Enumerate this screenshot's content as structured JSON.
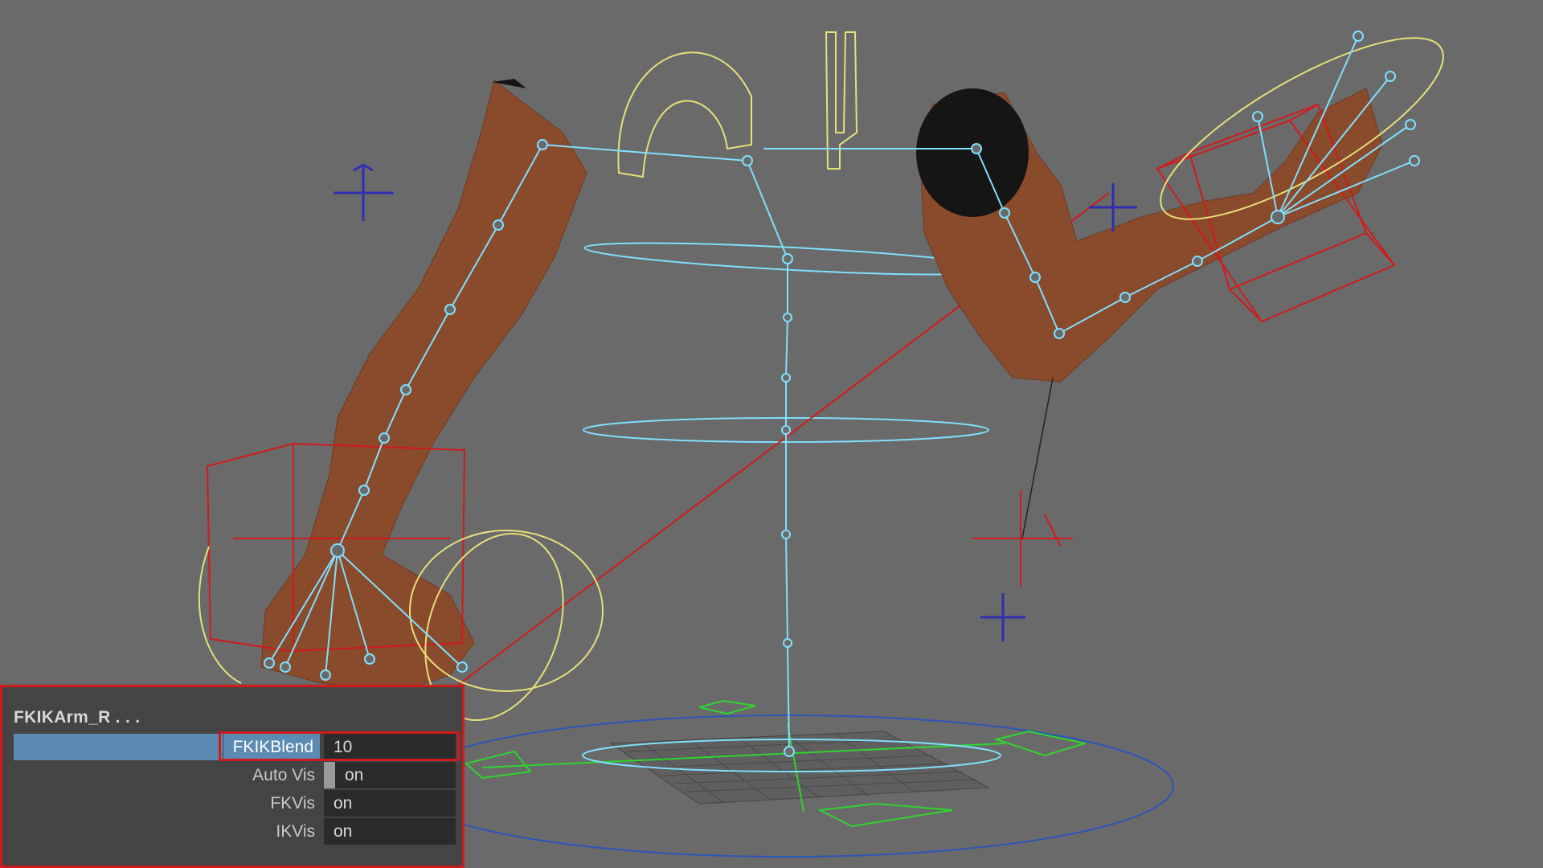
{
  "viewport": {
    "colors": {
      "background": "#6a6a6a",
      "skin": "#8a4a2c",
      "joint": "#7fe0ff",
      "control_yellow": "#e6e07a",
      "control_red": "#d11a1a",
      "locator_blue": "#2f2fb0",
      "ground_green": "#2fd52f",
      "ground_blue": "#2b55b8"
    }
  },
  "channel_box": {
    "title": "FKIKArm_R . . .",
    "rows": [
      {
        "label": "FKIKBlend",
        "value": "10",
        "selected": true
      },
      {
        "label": "Auto Vis",
        "value": "on"
      },
      {
        "label": "FKVis",
        "value": "on"
      },
      {
        "label": "IKVis",
        "value": "on"
      }
    ],
    "highlight_color": "#d11a1a",
    "selection_color": "#5b8ab3"
  }
}
